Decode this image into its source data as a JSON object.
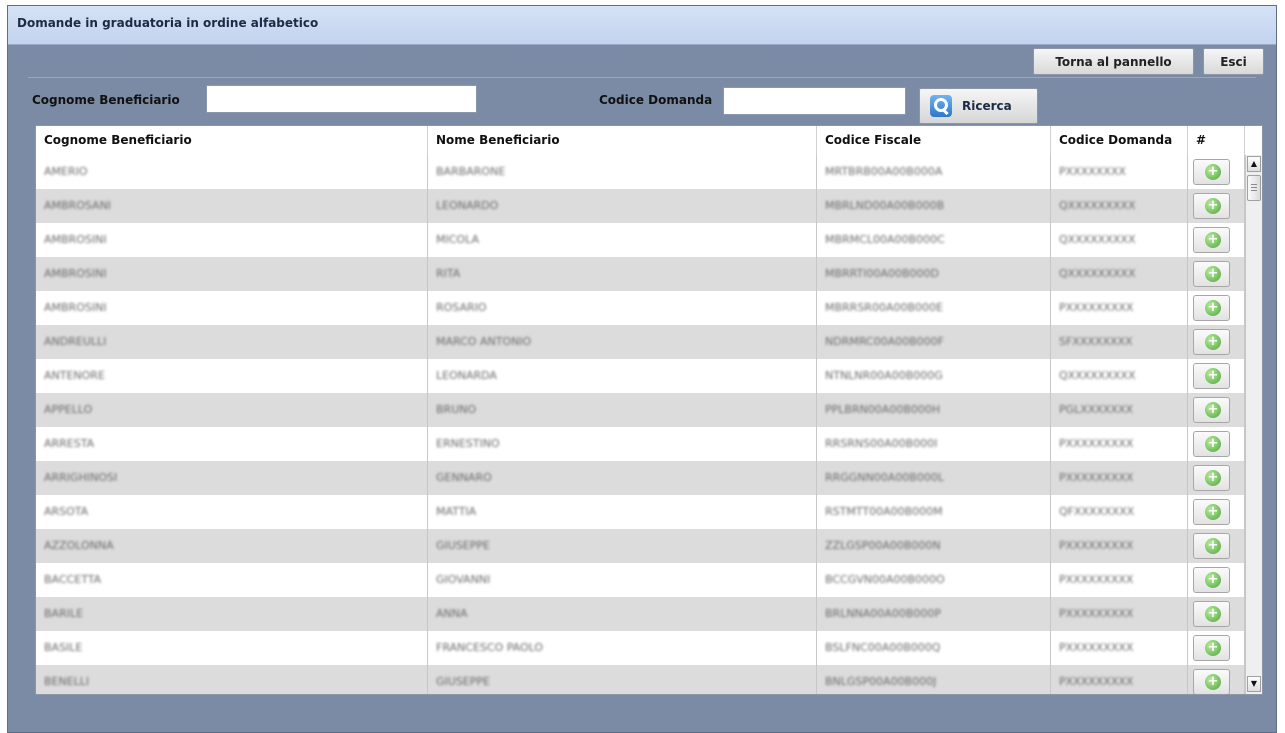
{
  "window": {
    "title": "Domande in graduatoria in ordine alfabetico"
  },
  "toolbar": {
    "back_label": "Torna al pannello",
    "exit_label": "Esci"
  },
  "filters": {
    "surname_label": "Cognome Beneficiario",
    "surname_value": "",
    "code_label": "Codice Domanda",
    "code_value": "",
    "search_label": "Ricerca",
    "search_icon": "search-icon"
  },
  "table": {
    "columns": [
      "Cognome Beneficiario",
      "Nome Beneficiario",
      "Codice Fiscale",
      "Codice Domanda",
      "#"
    ],
    "rows": [
      [
        "AMERIO",
        "BARBARONE",
        "MRTBRB00A00B000A",
        "PXXXXXXXX"
      ],
      [
        "AMBROSANI",
        "LEONARDO",
        "MBRLND00A00B000B",
        "QXXXXXXXXX"
      ],
      [
        "AMBROSINI",
        "MICOLA",
        "MBRMCL00A00B000C",
        "QXXXXXXXXX"
      ],
      [
        "AMBROSINI",
        "RITA",
        "MBRRTI00A00B000D",
        "QXXXXXXXXX"
      ],
      [
        "AMBROSINI",
        "ROSARIO",
        "MBRRSR00A00B000E",
        "PXXXXXXXXX"
      ],
      [
        "ANDREULLI",
        "MARCO ANTONIO",
        "NDRMRC00A00B000F",
        "SFXXXXXXXX"
      ],
      [
        "ANTENORE",
        "LEONARDA",
        "NTNLNR00A00B000G",
        "QXXXXXXXXX"
      ],
      [
        "APPELLO",
        "BRUNO",
        "PPLBRN00A00B000H",
        "PGLXXXXXXX"
      ],
      [
        "ARRESTA",
        "ERNESTINO",
        "RRSRNS00A00B000I",
        "PXXXXXXXXX"
      ],
      [
        "ARRIGHINOSI",
        "GENNARO",
        "RRGGNN00A00B000L",
        "PXXXXXXXXX"
      ],
      [
        "ARSOTA",
        "MATTIA",
        "RSTMTT00A00B000M",
        "QFXXXXXXXX"
      ],
      [
        "AZZOLONNA",
        "GIUSEPPE",
        "ZZLGSP00A00B000N",
        "PXXXXXXXXX"
      ],
      [
        "BACCETTA",
        "GIOVANNI",
        "BCCGVN00A00B000O",
        "PXXXXXXXXX"
      ],
      [
        "BARILE",
        "ANNA",
        "BRLNNA00A00B000P",
        "PXXXXXXXXX"
      ],
      [
        "BASILE",
        "FRANCESCO PAOLO",
        "BSLFNC00A00B000Q",
        "PXXXXXXXXX"
      ],
      [
        "BENELLI",
        "GIUSEPPE",
        "BNLGSP00A00B000J",
        "PXXXXXXXXX"
      ]
    ]
  },
  "colors": {
    "background": "#7b8ba5",
    "title_bar": "#c8d7f0",
    "row_alt": "#dcdcdc",
    "add_icon": "#4fa53b"
  }
}
